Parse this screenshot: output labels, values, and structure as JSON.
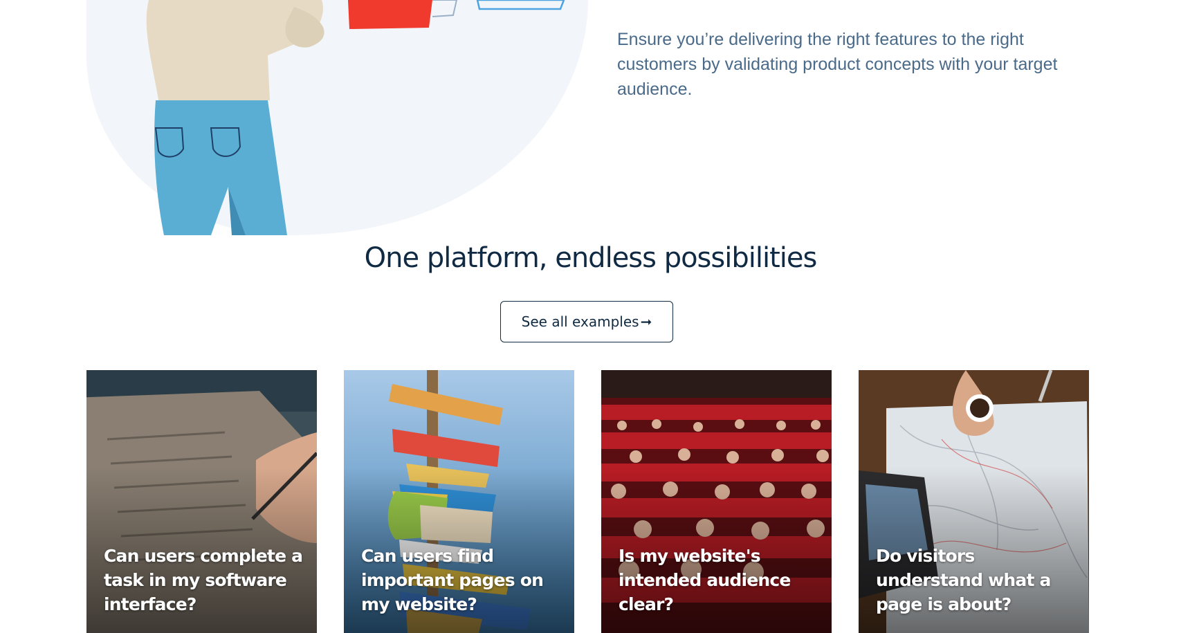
{
  "hero": {
    "description": "Ensure you’re delivering the right features to the right customers by validating product concepts with your target audience."
  },
  "section": {
    "title": "One platform, endless possibilities",
    "button_label": "See all examples",
    "button_arrow": "➞"
  },
  "cards": [
    {
      "caption": "Can users complete a task in my software interface?",
      "image": "checklist-photo"
    },
    {
      "caption": "Can users find important pages on my website?",
      "image": "signpost-photo"
    },
    {
      "caption": "Is my website's intended audience clear?",
      "image": "theater-audience-photo"
    },
    {
      "caption": "Do visitors understand what a page is about?",
      "image": "map-laptop-photo"
    }
  ],
  "colors": {
    "heading": "#102a43",
    "body_text": "#4a6a8a",
    "hero_blob": "#f2f6fa",
    "shirt": "#e6dac4",
    "jeans": "#5aaed3",
    "red_card": "#f03a2e"
  }
}
